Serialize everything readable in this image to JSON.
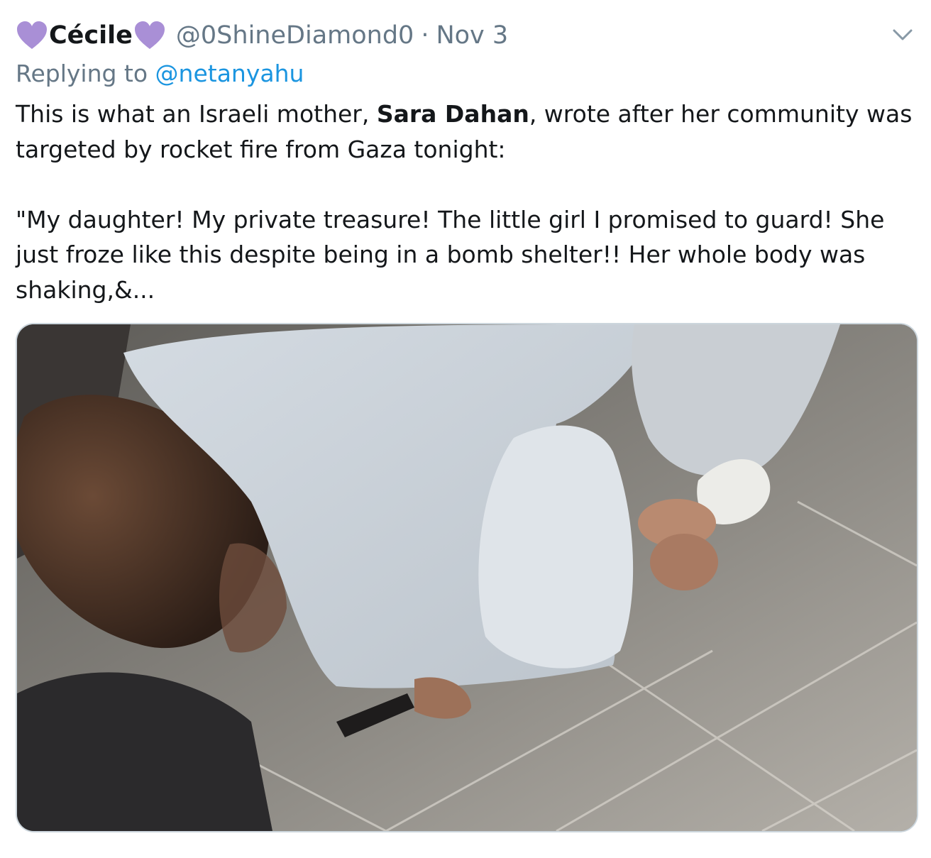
{
  "tweet": {
    "display_name": "Cécile",
    "handle": "@0ShineDiamond0",
    "separator": "·",
    "date": "Nov 3",
    "replying_prefix": "Replying to",
    "replying_to": "@netanyahu",
    "text_part1": "This is what an Israeli mother, ",
    "text_bold": "Sara Dahan",
    "text_part2": ", wrote after her community was targeted by rocket fire from Gaza tonight:",
    "quote": "\"My daughter! My private treasure! The little girl I promised to guard! She just froze like this despite being in a bomb shelter!! Her whole body was shaking,&...",
    "heart_color": "#a98fd6",
    "link_color": "#1b95e0",
    "muted_color": "#657786"
  },
  "icons": {
    "name_left": "purple-heart-icon",
    "name_right": "purple-heart-icon",
    "menu": "chevron-down-icon"
  }
}
